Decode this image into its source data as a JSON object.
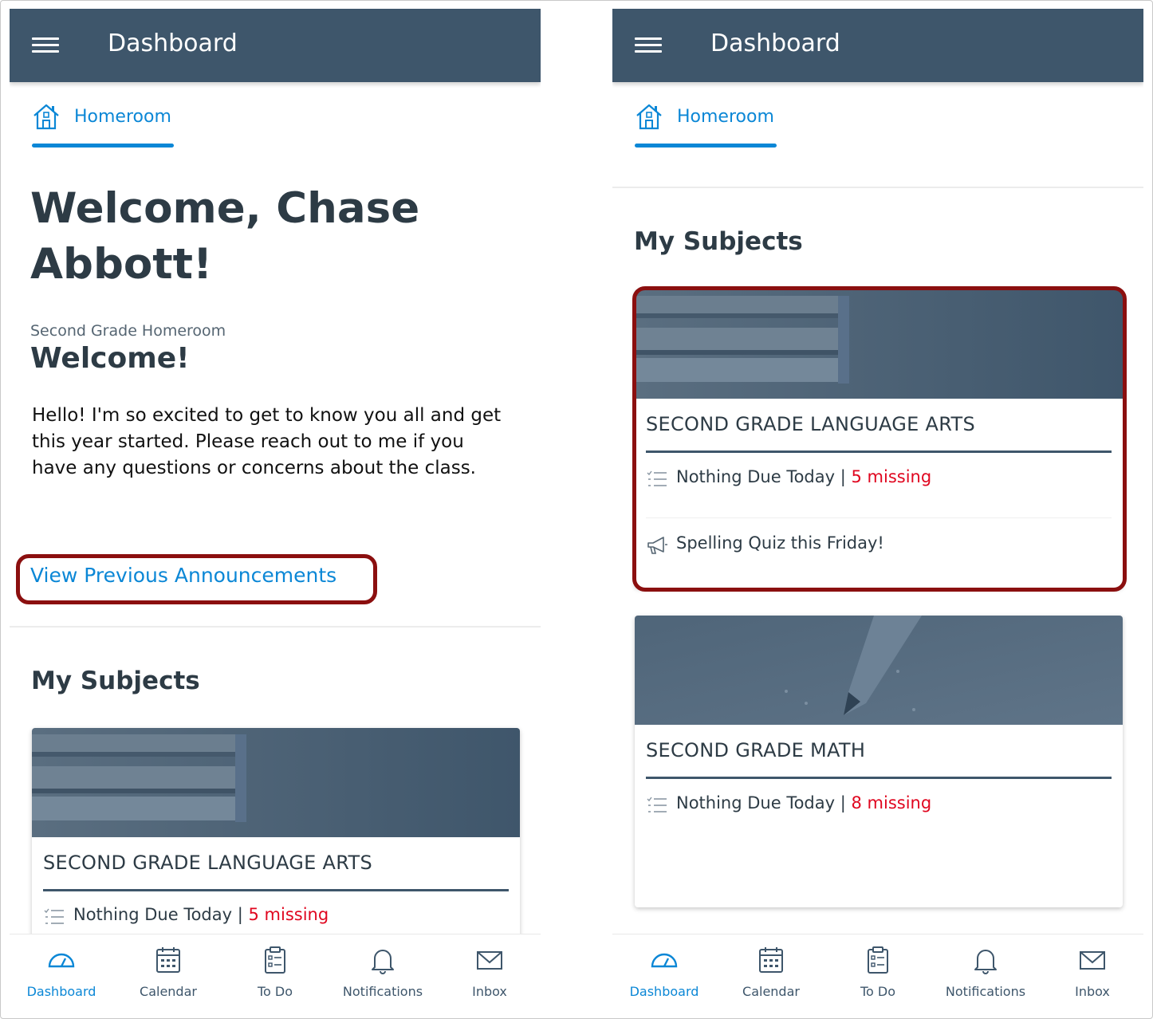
{
  "colors": {
    "appbar": "#3e566b",
    "accent": "#0b87d6",
    "missing": "#e0061f",
    "highlight": "#8b0f0f",
    "text": "#2d3b45"
  },
  "left": {
    "appbar": {
      "title": "Dashboard",
      "menu_icon": "hamburger-menu-icon"
    },
    "tab": {
      "label": "Homeroom",
      "icon": "home-icon"
    },
    "welcome": "Welcome, Chase Abbott!",
    "homeroom": {
      "subtitle": "Second Grade Homeroom",
      "heading": "Welcome!",
      "body": "Hello! I'm so excited to get to know you all and get this year started. Please reach out to me if you have any questions or concerns about the class."
    },
    "view_previous": "View Previous Announcements",
    "subjects_title": "My Subjects",
    "cards": [
      {
        "title": "SECOND GRADE LANGUAGE ARTS",
        "due": "Nothing Due Today | ",
        "missing": "5 missing"
      }
    ]
  },
  "right": {
    "appbar": {
      "title": "Dashboard",
      "menu_icon": "hamburger-menu-icon"
    },
    "tab": {
      "label": "Homeroom",
      "icon": "home-icon"
    },
    "subjects_title": "My Subjects",
    "cards": [
      {
        "title": "SECOND GRADE LANGUAGE ARTS",
        "due": "Nothing Due Today | ",
        "missing": "5 missing",
        "announcement": "Spelling Quiz this Friday!"
      },
      {
        "title": "SECOND GRADE MATH",
        "due": "Nothing Due Today | ",
        "missing": "8 missing"
      }
    ]
  },
  "bottom_nav": [
    {
      "label": "Dashboard",
      "icon": "dashboard-icon",
      "active": true
    },
    {
      "label": "Calendar",
      "icon": "calendar-icon",
      "active": false
    },
    {
      "label": "To Do",
      "icon": "todo-clipboard-icon",
      "active": false
    },
    {
      "label": "Notifications",
      "icon": "bell-icon",
      "active": false
    },
    {
      "label": "Inbox",
      "icon": "inbox-envelope-icon",
      "active": false
    }
  ]
}
